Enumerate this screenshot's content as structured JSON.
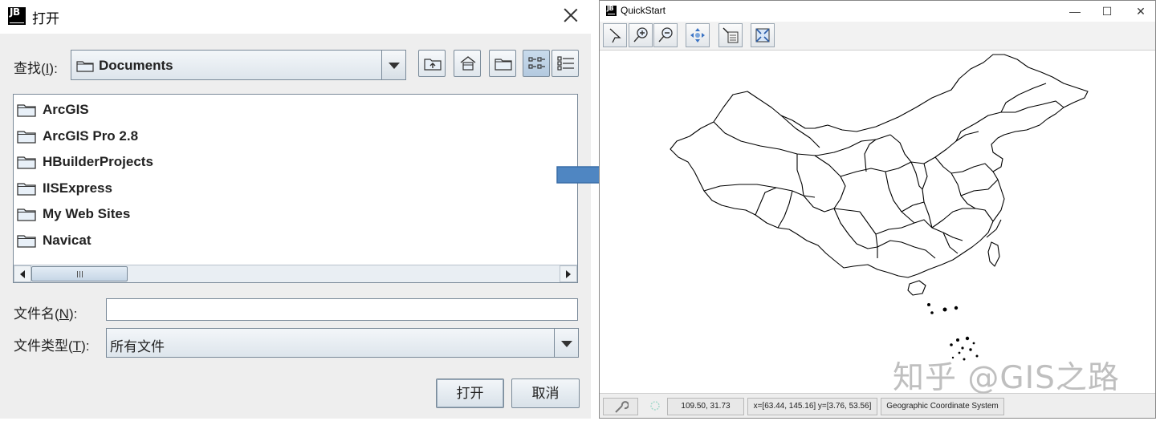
{
  "open_dialog": {
    "logo": "JB",
    "title": "打开",
    "look_in": {
      "label": "查找(",
      "mnemonic": "I",
      "label_end": "):",
      "value": "Documents"
    },
    "toolbar_icons": [
      "up-one-level-icon",
      "home-icon",
      "new-folder-icon",
      "list-view-icon",
      "details-view-icon"
    ],
    "files": [
      "ArcGIS",
      "ArcGIS Pro 2.8",
      "HBuilderProjects",
      "IISExpress",
      "My Web Sites",
      "Navicat"
    ],
    "file_name": {
      "label": "文件名(",
      "mnemonic": "N",
      "label_end": "):",
      "value": ""
    },
    "file_type": {
      "label": "文件类型(",
      "mnemonic": "T",
      "label_end": "):",
      "value": "所有文件"
    },
    "open_button": "打开",
    "cancel_button": "取消"
  },
  "quickstart": {
    "logo": "JB",
    "title": "QuickStart",
    "window_buttons": [
      "—",
      "☐",
      "✕"
    ],
    "tools": [
      "pointer-icon",
      "zoom-in-icon",
      "zoom-out-icon",
      "pan-icon",
      "info-icon",
      "reset-icon"
    ],
    "status": {
      "coords": "109.50, 31.73",
      "bounds": "x=[63.44, 145.16] y=[3.76, 53.56]",
      "crs": "Geographic Coordinate System"
    }
  },
  "watermark": "知乎 @GIS之路"
}
